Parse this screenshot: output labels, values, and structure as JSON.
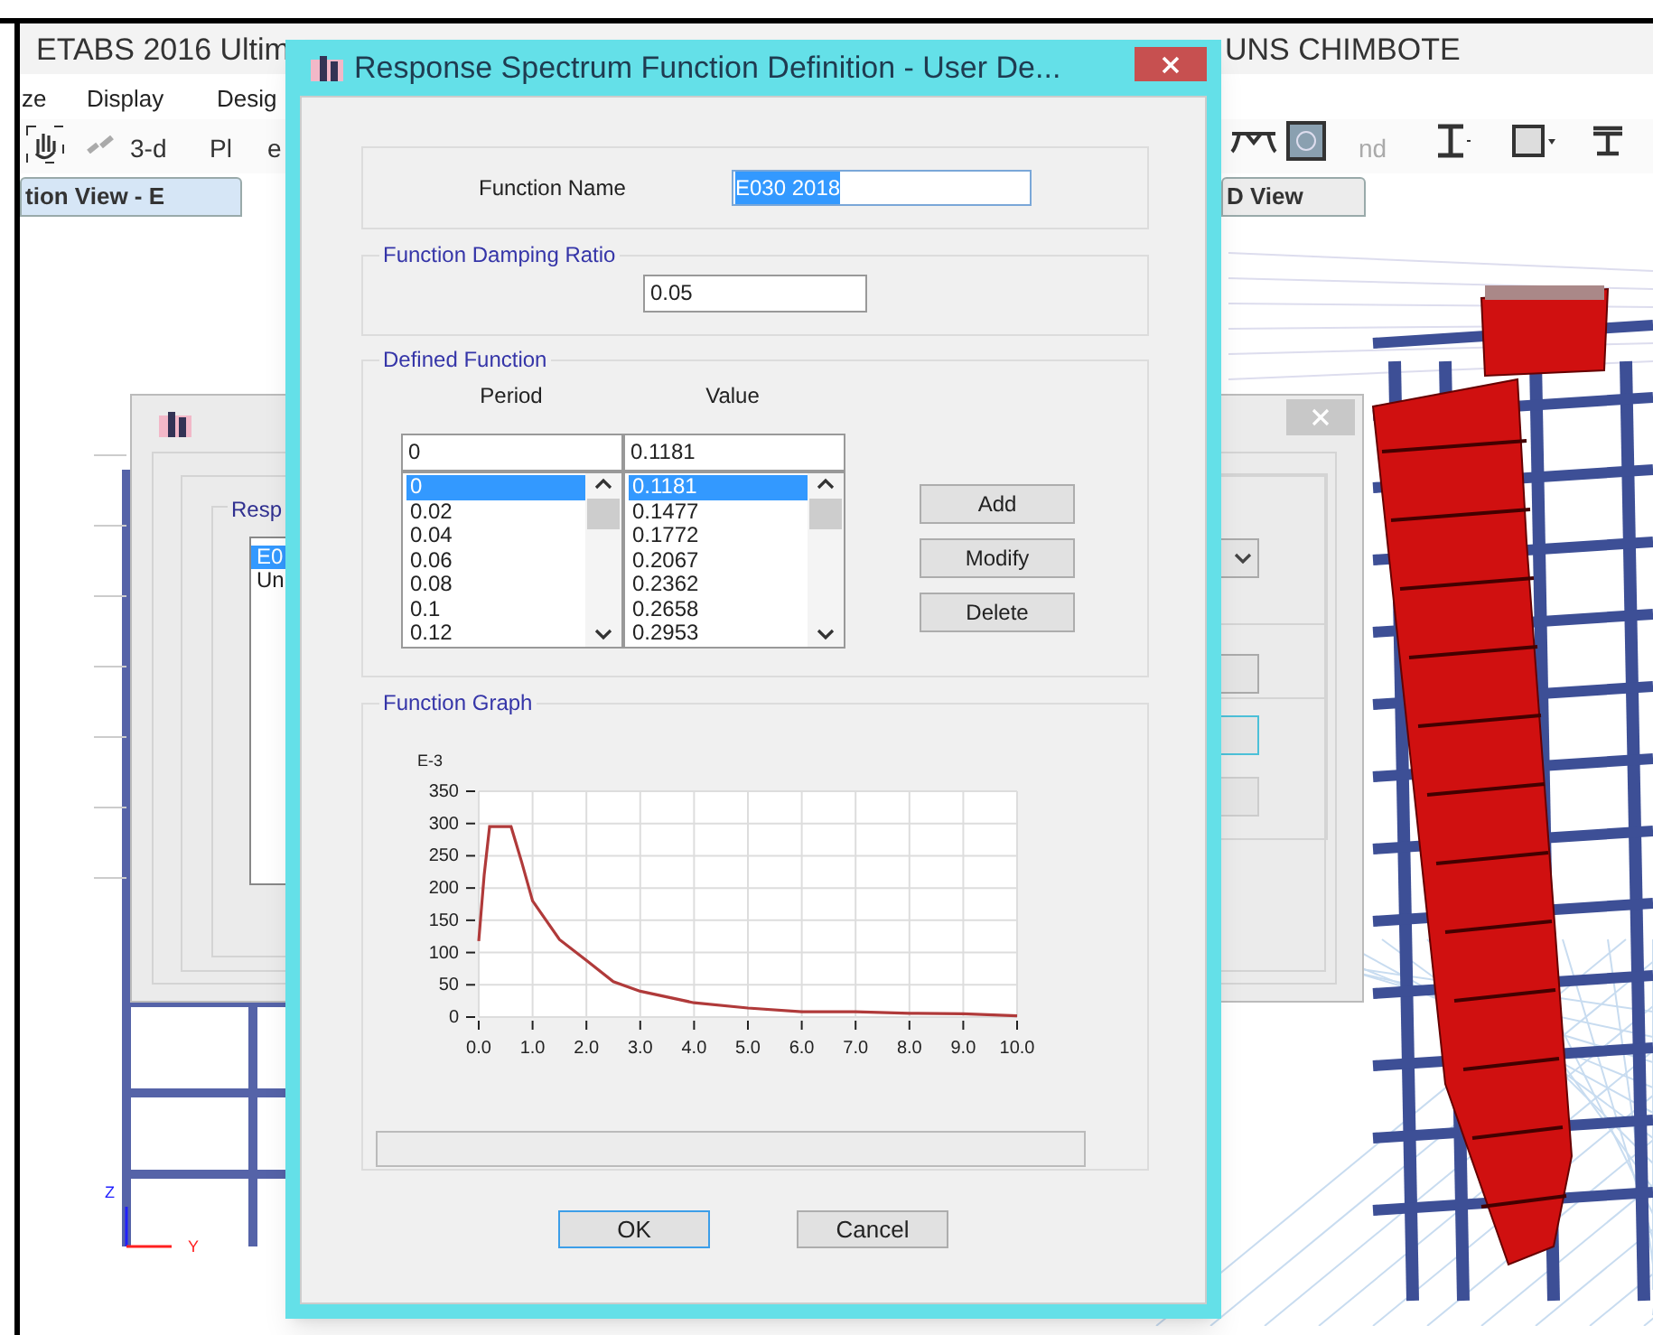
{
  "app": {
    "title_left": "ETABS 2016 Ultim",
    "title_right": "UNS CHIMBOTE",
    "menu": [
      "ze",
      "Display",
      "Desig"
    ],
    "toolbar_texts": [
      "3-d",
      "Pl",
      "e",
      "nd"
    ],
    "tabs": [
      {
        "label": "tion View - E",
        "selected": true
      },
      {
        "label": "D View",
        "selected": false
      }
    ],
    "axes": [
      "Z",
      "Y"
    ]
  },
  "background_dialog": {
    "group_label": "Resp",
    "list_items": [
      {
        "label": "E0",
        "selected": true
      },
      {
        "label": "Un",
        "selected": false
      }
    ]
  },
  "dialog": {
    "title": "Response Spectrum Function Definition - User De...",
    "function_name": {
      "label": "Function Name",
      "value": "E030 2018",
      "text_selected": true
    },
    "damping": {
      "legend": "Function Damping Ratio",
      "value": "0.05"
    },
    "defined_function": {
      "legend": "Defined Function",
      "columns": [
        "Period",
        "Value"
      ],
      "period_input": "0",
      "value_input": "0.1181",
      "rows": [
        {
          "period": "0",
          "value": "0.1181",
          "selected": true
        },
        {
          "period": "0.02",
          "value": "0.1477",
          "selected": false
        },
        {
          "period": "0.04",
          "value": "0.1772",
          "selected": false
        },
        {
          "period": "0.06",
          "value": "0.2067",
          "selected": false
        },
        {
          "period": "0.08",
          "value": "0.2362",
          "selected": false
        },
        {
          "period": "0.1",
          "value": "0.2658",
          "selected": false
        },
        {
          "period": "0.12",
          "value": "0.2953",
          "selected": false
        }
      ],
      "buttons": [
        "Add",
        "Modify",
        "Delete"
      ]
    },
    "graph": {
      "legend": "Function Graph",
      "chart_data": {
        "type": "line",
        "ylabel": "E-3",
        "x": [
          0,
          0.1,
          0.2,
          0.6,
          0.8,
          1,
          1.5,
          2,
          2.5,
          3,
          4,
          5,
          6,
          7,
          8,
          9,
          10
        ],
        "grid": true,
        "series": [
          {
            "color": "#b03a3a",
            "values": [
              118,
              220,
              295,
              295,
              240,
              180,
              120,
              88,
              55,
              40,
              22,
              14,
              8,
              8,
              6,
              5,
              2
            ]
          }
        ],
        "xlim": [
          0,
          10
        ],
        "ylim": [
          0,
          350
        ],
        "xticks": [
          {
            "value": 0,
            "label": "0.0"
          },
          {
            "value": 1,
            "label": "1.0"
          },
          {
            "value": 2,
            "label": "2.0"
          },
          {
            "value": 3,
            "label": "3.0"
          },
          {
            "value": 4,
            "label": "4.0"
          },
          {
            "value": 5,
            "label": "5.0"
          },
          {
            "value": 6,
            "label": "6.0"
          },
          {
            "value": 7,
            "label": "7.0"
          },
          {
            "value": 8,
            "label": "8.0"
          },
          {
            "value": 9,
            "label": "9.0"
          },
          {
            "value": 10,
            "label": "10.0"
          }
        ],
        "yticks": [
          0,
          50,
          100,
          150,
          200,
          250,
          300,
          350
        ]
      }
    },
    "footer_buttons": [
      {
        "label": "OK",
        "default": true
      },
      {
        "label": "Cancel",
        "default": false
      }
    ]
  }
}
